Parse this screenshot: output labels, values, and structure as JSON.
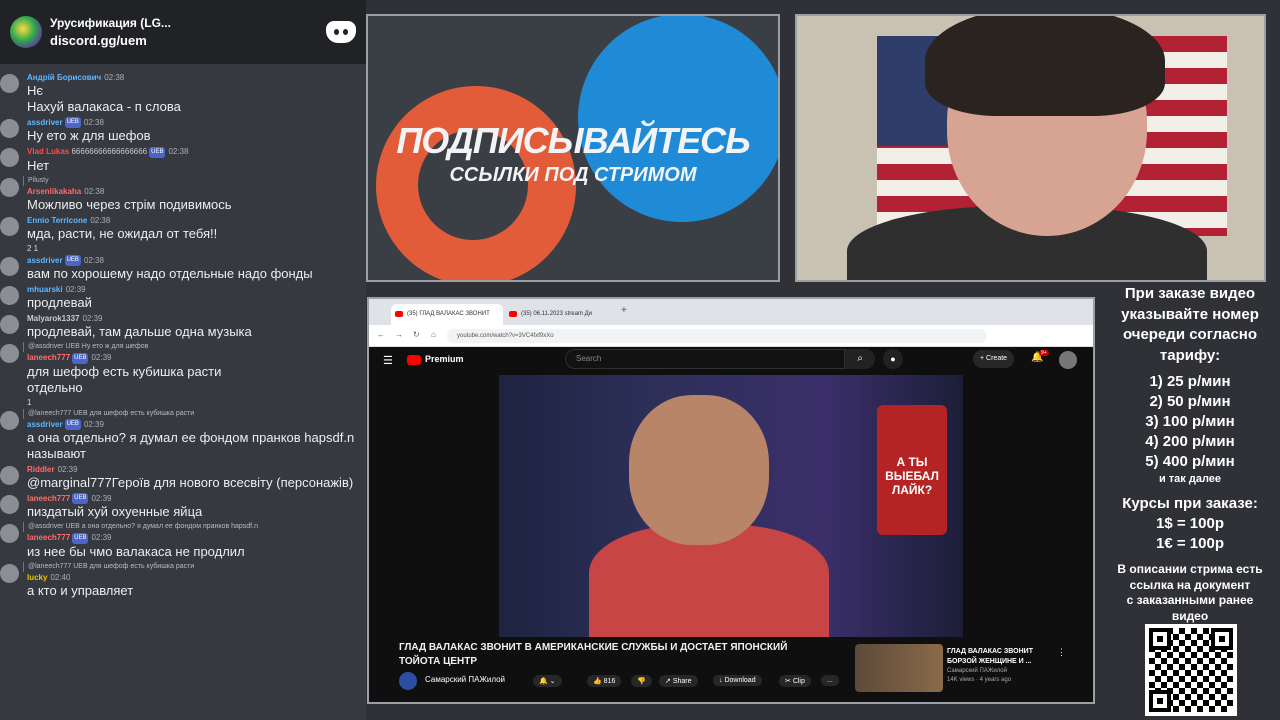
{
  "chat": {
    "server_name": "Урусификация (LG...",
    "server_link": "discord.gg/uem",
    "messages": [
      {
        "author": "Андрій Борисович",
        "time": "02:38",
        "color": "#5fb6ff",
        "lines": [
          "Нє",
          "Нахуй валакаса - п слова"
        ]
      },
      {
        "author": "assdriver",
        "time": "02:38",
        "color": "#5fb6ff",
        "badge": "UEB",
        "lines": [
          "Ну ето ж для шефов"
        ]
      },
      {
        "author": "Vlad Lukas",
        "time": "02:38",
        "color": "#ff4b4b",
        "extra": "66666666666666666",
        "badge": "UEB",
        "lines": [
          "Нет"
        ]
      },
      {
        "author": "Arsenlikakaha",
        "time": "02:38",
        "color": "#ff6b6b",
        "reply": "Pilusty",
        "lines": [
          "Можливо через стрім подивимось"
        ]
      },
      {
        "author": "Ennio Terricone",
        "time": "02:38",
        "color": "#5fb6ff",
        "lines": [
          "мда, расти, не ожидал от тебя!!"
        ],
        "reactions": "2   1"
      },
      {
        "author": "assdriver",
        "time": "02:38",
        "color": "#5fb6ff",
        "badge": "UEB",
        "lines": [
          "вам по хорошему надо отдельные надо фонды"
        ]
      },
      {
        "author": "mhuarski",
        "time": "02:39",
        "color": "#5fb6ff",
        "lines": [
          "продлевай"
        ]
      },
      {
        "author": "Malyarok1337",
        "time": "02:39",
        "color": "#c9cdd2",
        "lines": [
          "продлевай, там дальше одна музыка"
        ]
      },
      {
        "author": "laneech777",
        "time": "02:39",
        "color": "#ff6b6b",
        "badge": "UEB",
        "reply": "@assdriver UEB Ну ето ж для шефов",
        "lines": [
          "для шефоф есть кубишка расти",
          "отдельно"
        ],
        "reactions": "1"
      },
      {
        "author": "assdriver",
        "time": "02:39",
        "color": "#5fb6ff",
        "badge": "UEB",
        "reply": "@laneech777 UEB для шефоф есть кубишка расти",
        "lines": [
          "а она отдельно? я думал ее фондом пранков hapsdf.n",
          "называют"
        ]
      },
      {
        "author": "Riddler",
        "time": "02:39",
        "color": "#ff6b6b",
        "lines": [
          "@marginal777Героїв для нового всесвіту (персонажів)"
        ]
      },
      {
        "author": "laneech777",
        "time": "02:39",
        "color": "#ff6b6b",
        "badge": "UEB",
        "lines": [
          "пиздатый хуй охуенные яйца"
        ]
      },
      {
        "author": "laneech777",
        "time": "02:39",
        "color": "#ff6b6b",
        "badge": "UEB",
        "reply": "@assdriver UEB а она отдельно? я думал ее фондом пранков hapsdf.n",
        "lines": [
          "из нее бы чмо валакаса не продлил"
        ]
      },
      {
        "author": "lucky",
        "time": "02:40",
        "color": "#f0c000",
        "reply": "@laneech777 UEB для шефоф есть кубишка расти",
        "lines": [
          "а кто и управляет"
        ]
      }
    ]
  },
  "promo": {
    "title": "ПОДПИСЫВАЙТЕСЬ",
    "subtitle": "ССЫЛКИ ПОД СТРИМОМ"
  },
  "browser": {
    "tab1": "(35) ГЛАД ВАЛАКАС ЗВОНИТ",
    "tab2": "(35) 06.11.2023 stream Ди",
    "url": "youtube.com/watch?v=3VC4fxf9xXo"
  },
  "youtube": {
    "premium": "Premium",
    "search_placeholder": "Search",
    "create": "Create",
    "notifications": "9+",
    "video_title": "ГЛАД ВАЛАКАС ЗВОНИТ В АМЕРИКАНСКИЕ СЛУЖБЫ И ДОСТАЕТ ЯПОНСКИЙ ТОЙОТА ЦЕНТР",
    "channel": "Самарский ПАЖилой",
    "likes": "816",
    "share": "Share",
    "download": "Download",
    "clip": "Clip",
    "more": "...",
    "poster_text": "А ТЫ ВЫЕБАЛ ЛАЙК?",
    "side_title": "ГЛАД ВАЛАКАС ЗВОНИТ БОРЗОЙ ЖЕНЩИНЕ И ...",
    "side_channel": "Самарский ПАЖилой",
    "side_meta": "14K views · 4 years ago"
  },
  "info": {
    "header": [
      "При заказе видео",
      "указывайте номер",
      "очереди согласно",
      "тарифу:"
    ],
    "tariffs": [
      "1) 25 р/мин",
      "2) 50 р/мин",
      "3) 100 р/мин",
      "4) 200 р/мин",
      "5) 400 р/мин"
    ],
    "etc": "и так далее",
    "rates_title": "Курсы при заказе:",
    "rates": [
      "1$ = 100р",
      "1€ = 100р"
    ],
    "doc_note": [
      "В описании стрима есть",
      "ссылка на документ",
      "с заказанными ранее",
      "видео"
    ]
  }
}
